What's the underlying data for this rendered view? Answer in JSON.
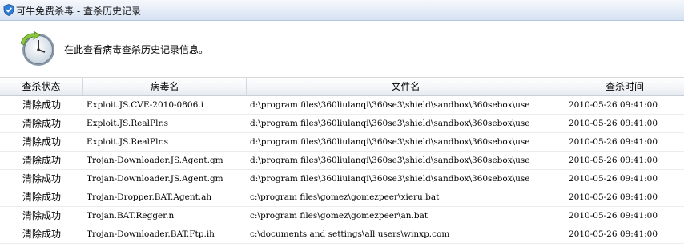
{
  "window": {
    "title": "可牛免费杀毒 - 查杀历史记录",
    "icon": "shield-icon"
  },
  "header": {
    "icon": "clock-restore-icon",
    "text": "在此查看病毒查杀历史记录信息。"
  },
  "table": {
    "columns": [
      "查杀状态",
      "病毒名",
      "文件名",
      "查杀时间"
    ],
    "rows": [
      {
        "status": "清除成功",
        "virus": "Exploit.JS.CVE-2010-0806.i",
        "file": "d:\\program files\\360liulanqi\\360se3\\shield\\sandbox\\360sebox\\use",
        "time": "2010-05-26 09:41:00"
      },
      {
        "status": "清除成功",
        "virus": "Exploit.JS.RealPlr.s",
        "file": "d:\\program files\\360liulanqi\\360se3\\shield\\sandbox\\360sebox\\use",
        "time": "2010-05-26 09:41:00"
      },
      {
        "status": "清除成功",
        "virus": "Exploit.JS.RealPlr.s",
        "file": "d:\\program files\\360liulanqi\\360se3\\shield\\sandbox\\360sebox\\use",
        "time": "2010-05-26 09:41:00"
      },
      {
        "status": "清除成功",
        "virus": "Trojan-Downloader.JS.Agent.gm",
        "file": "d:\\program files\\360liulanqi\\360se3\\shield\\sandbox\\360sebox\\use",
        "time": "2010-05-26 09:41:00"
      },
      {
        "status": "清除成功",
        "virus": "Trojan-Downloader.JS.Agent.gm",
        "file": "d:\\program files\\360liulanqi\\360se3\\shield\\sandbox\\360sebox\\use",
        "time": "2010-05-26 09:41:00"
      },
      {
        "status": "清除成功",
        "virus": "Trojan-Dropper.BAT.Agent.ah",
        "file": "c:\\program files\\gomez\\gomezpeer\\xieru.bat",
        "time": "2010-05-26 09:41:00"
      },
      {
        "status": "清除成功",
        "virus": "Trojan.BAT.Regger.n",
        "file": "c:\\program files\\gomez\\gomezpeer\\an.bat",
        "time": "2010-05-26 09:41:00"
      },
      {
        "status": "清除成功",
        "virus": "Trojan-Downloader.BAT.Ftp.ih",
        "file": "c:\\documents and settings\\all users\\winxp.com",
        "time": "2010-05-26 09:41:00"
      }
    ]
  }
}
